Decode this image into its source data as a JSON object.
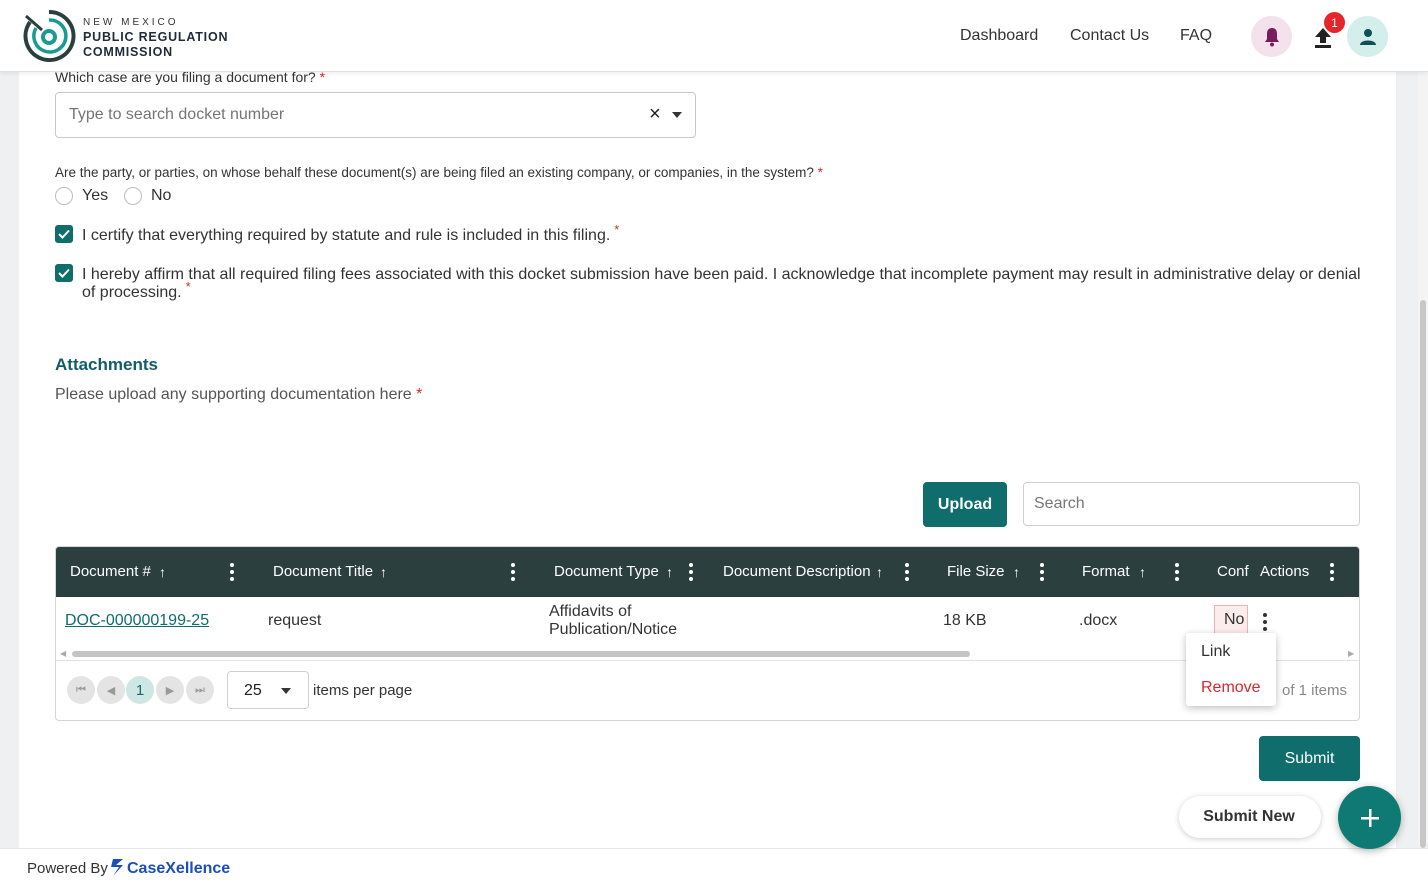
{
  "header": {
    "logo": {
      "line1": "NEW MEXICO",
      "line2": "PUBLIC REGULATION",
      "line3": "COMMISSION"
    },
    "nav": [
      {
        "label": "Dashboard"
      },
      {
        "label": "Contact Us"
      },
      {
        "label": "FAQ"
      }
    ],
    "upload_badge": "1",
    "icons": [
      "bell-icon",
      "upload-icon",
      "user-icon"
    ]
  },
  "form": {
    "case_label": "Which case are you filing a document for?",
    "case_placeholder": "Type to search docket number",
    "party_label": "Are the party, or parties, on whose behalf these document(s) are being filed an existing company, or companies, in the system?",
    "yes_label": "Yes",
    "no_label": "No",
    "certify_text": "I certify that everything required by statute and rule is included in this filing.",
    "affirm_text": "I hereby affirm that all required filing fees associated with this docket submission have been paid. I acknowledge that incomplete payment may result in administrative delay or denial of processing.",
    "required_mark": "*"
  },
  "attachments": {
    "title": "Attachments",
    "subtitle": "Please upload any supporting documentation here",
    "upload_label": "Upload",
    "search_placeholder": "Search"
  },
  "table": {
    "columns": [
      "Document #",
      "Document Title",
      "Document Type",
      "Document Description",
      "File Size",
      "Format",
      "Conf",
      "Actions"
    ],
    "rows": [
      {
        "doc_number": "DOC-000000199-25",
        "title": "request",
        "type_line1": "Affidavits of",
        "type_line2": "Publication/Notice",
        "description": "",
        "file_size": "18 KB",
        "format": ".docx",
        "conf": "No"
      }
    ],
    "pager": {
      "current_page": "1",
      "page_size": "25",
      "items_per_page_label": "items per page",
      "info": "of 1 items"
    }
  },
  "action_menu": {
    "link": "Link",
    "remove": "Remove"
  },
  "buttons": {
    "submit": "Submit",
    "submit_new": "Submit New"
  },
  "footer": {
    "powered_by": "Powered By",
    "brand": "CaseXellence"
  },
  "colors": {
    "primary": "#0f6d6b",
    "header_row": "#2b3f3e",
    "danger": "#d9282f",
    "link": "#0f6d6b",
    "brand": "#1b4fb8"
  }
}
